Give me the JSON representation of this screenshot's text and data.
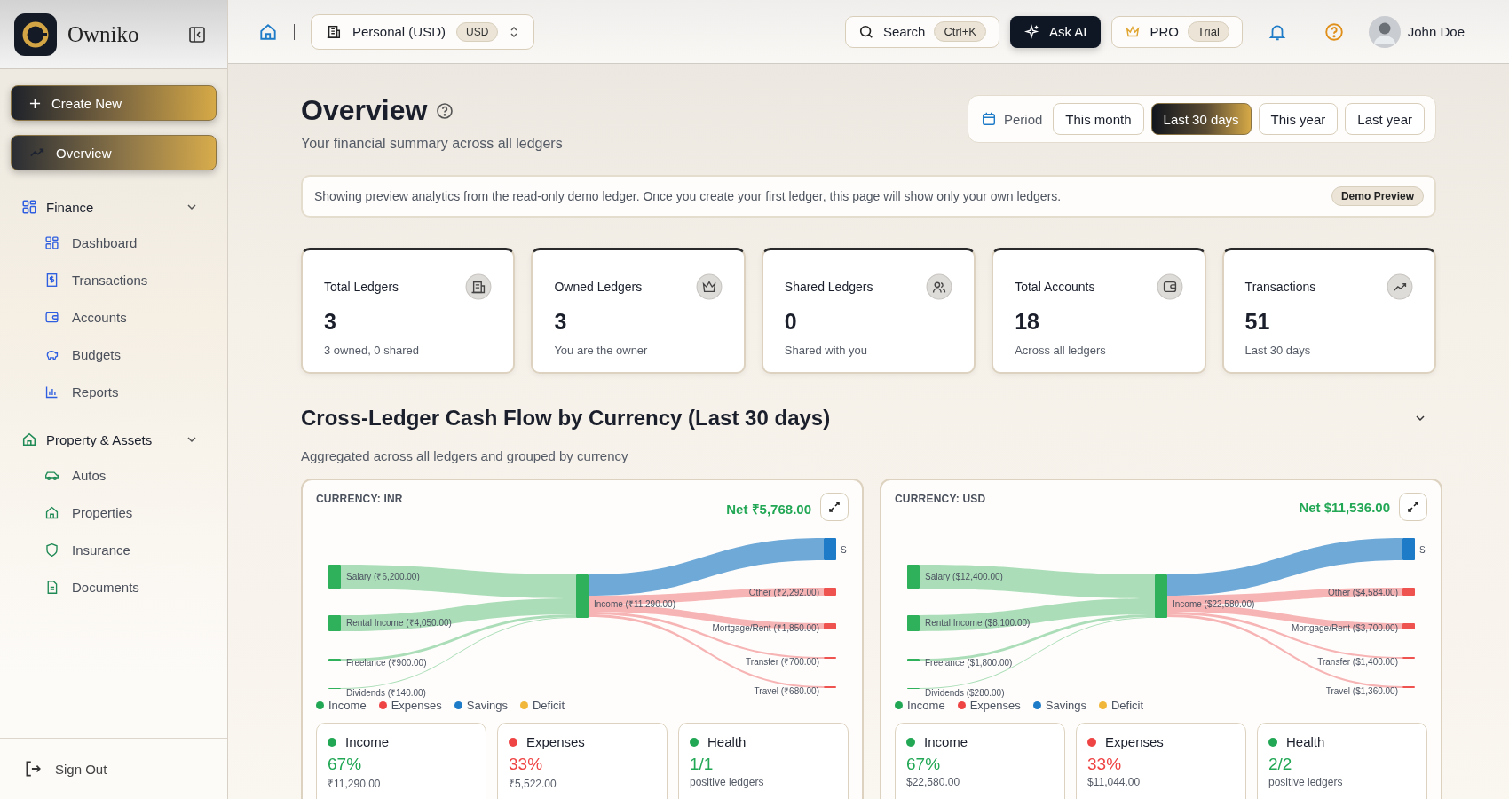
{
  "sidebar": {
    "brand": "Owniko",
    "create_button": "Create New",
    "nav": [
      {
        "label": "Overview",
        "selected": true
      }
    ],
    "groups": [
      {
        "label": "Finance",
        "expanded": true,
        "children": [
          {
            "label": "Dashboard"
          },
          {
            "label": "Transactions"
          },
          {
            "label": "Accounts"
          },
          {
            "label": "Budgets"
          },
          {
            "label": "Reports"
          }
        ]
      },
      {
        "label": "Property & Assets",
        "expanded": true,
        "children": [
          {
            "label": "Autos"
          },
          {
            "label": "Properties"
          },
          {
            "label": "Insurance"
          },
          {
            "label": "Documents"
          }
        ]
      }
    ],
    "sign_out": "Sign Out"
  },
  "topbar": {
    "ledger": "Personal (USD)",
    "ledger_badge": "USD",
    "search": "Search",
    "search_shortcut": "Ctrl+K",
    "ask_ai": "Ask AI",
    "plan": "PRO",
    "plan_badge": "Trial",
    "user": "John Doe"
  },
  "header": {
    "title": "Overview",
    "subtitle": "Your financial summary across all ledgers",
    "period_label": "Period",
    "periods": [
      {
        "label": "This month",
        "selected": false
      },
      {
        "label": "Last 30 days",
        "selected": true
      },
      {
        "label": "This year",
        "selected": false
      },
      {
        "label": "Last year",
        "selected": false
      }
    ]
  },
  "banner": {
    "text": "Showing preview analytics from the read-only demo ledger. Once you create your first ledger, this page will show only your own ledgers.",
    "badge": "Demo Preview"
  },
  "stats": [
    {
      "title": "Total Ledgers",
      "value": "3",
      "note": "3 owned, 0 shared"
    },
    {
      "title": "Owned Ledgers",
      "value": "3",
      "note": "You are the owner"
    },
    {
      "title": "Shared Ledgers",
      "value": "0",
      "note": "Shared with you"
    },
    {
      "title": "Total Accounts",
      "value": "18",
      "note": "Across all ledgers"
    },
    {
      "title": "Transactions",
      "value": "51",
      "note": "Last 30 days"
    }
  ],
  "cash_flow": {
    "title": "Cross-Ledger Cash Flow by Currency (Last 30 days)",
    "subtitle": "Aggregated across all ledgers and grouped by currency",
    "expanded": true,
    "currencies": [
      {
        "label": "CURRENCY: INR",
        "net": "Net ₹5,768.00",
        "sankey": {
          "sources": [
            "Salary (₹6,200.00)",
            "Rental Income (₹4,050.00)",
            "Freelance (₹900.00)",
            "Dividends (₹140.00)"
          ],
          "center": "Income (₹11,290.00)",
          "savings": "S",
          "expenses": [
            "Other (₹2,292.00)",
            "Mortgage/Rent (₹1,850.00)",
            "Transfer (₹700.00)",
            "Travel (₹680.00)"
          ]
        },
        "legend": [
          {
            "label": "Income",
            "color": "#22a755"
          },
          {
            "label": "Expenses",
            "color": "#ef4444"
          },
          {
            "label": "Savings",
            "color": "#1e7bc8"
          },
          {
            "label": "Deficit",
            "color": "#f0b73a"
          }
        ],
        "metrics": [
          {
            "label": "Income",
            "color": "#22a755",
            "value": "67%",
            "detail": "₹11,290.00"
          },
          {
            "label": "Expenses",
            "color": "#ef4444",
            "value": "33%",
            "detail": "₹5,522.00"
          },
          {
            "label": "Health",
            "color": "#22a755",
            "value": "1/1",
            "detail": "positive ledgers"
          }
        ]
      },
      {
        "label": "CURRENCY: USD",
        "net": "Net $11,536.00",
        "sankey": {
          "sources": [
            "Salary ($12,400.00)",
            "Rental Income ($8,100.00)",
            "Freelance ($1,800.00)",
            "Dividends ($280.00)"
          ],
          "center": "Income ($22,580.00)",
          "savings": "S",
          "expenses": [
            "Other ($4,584.00)",
            "Mortgage/Rent ($3,700.00)",
            "Transfer ($1,400.00)",
            "Travel ($1,360.00)"
          ]
        },
        "legend": [
          {
            "label": "Income",
            "color": "#22a755"
          },
          {
            "label": "Expenses",
            "color": "#ef4444"
          },
          {
            "label": "Savings",
            "color": "#1e7bc8"
          },
          {
            "label": "Deficit",
            "color": "#f0b73a"
          }
        ],
        "metrics": [
          {
            "label": "Income",
            "color": "#22a755",
            "value": "67%",
            "detail": "$22,580.00"
          },
          {
            "label": "Expenses",
            "color": "#ef4444",
            "value": "33%",
            "detail": "$11,044.00"
          },
          {
            "label": "Health",
            "color": "#22a755",
            "value": "2/2",
            "detail": "positive ledgers"
          }
        ]
      }
    ]
  }
}
